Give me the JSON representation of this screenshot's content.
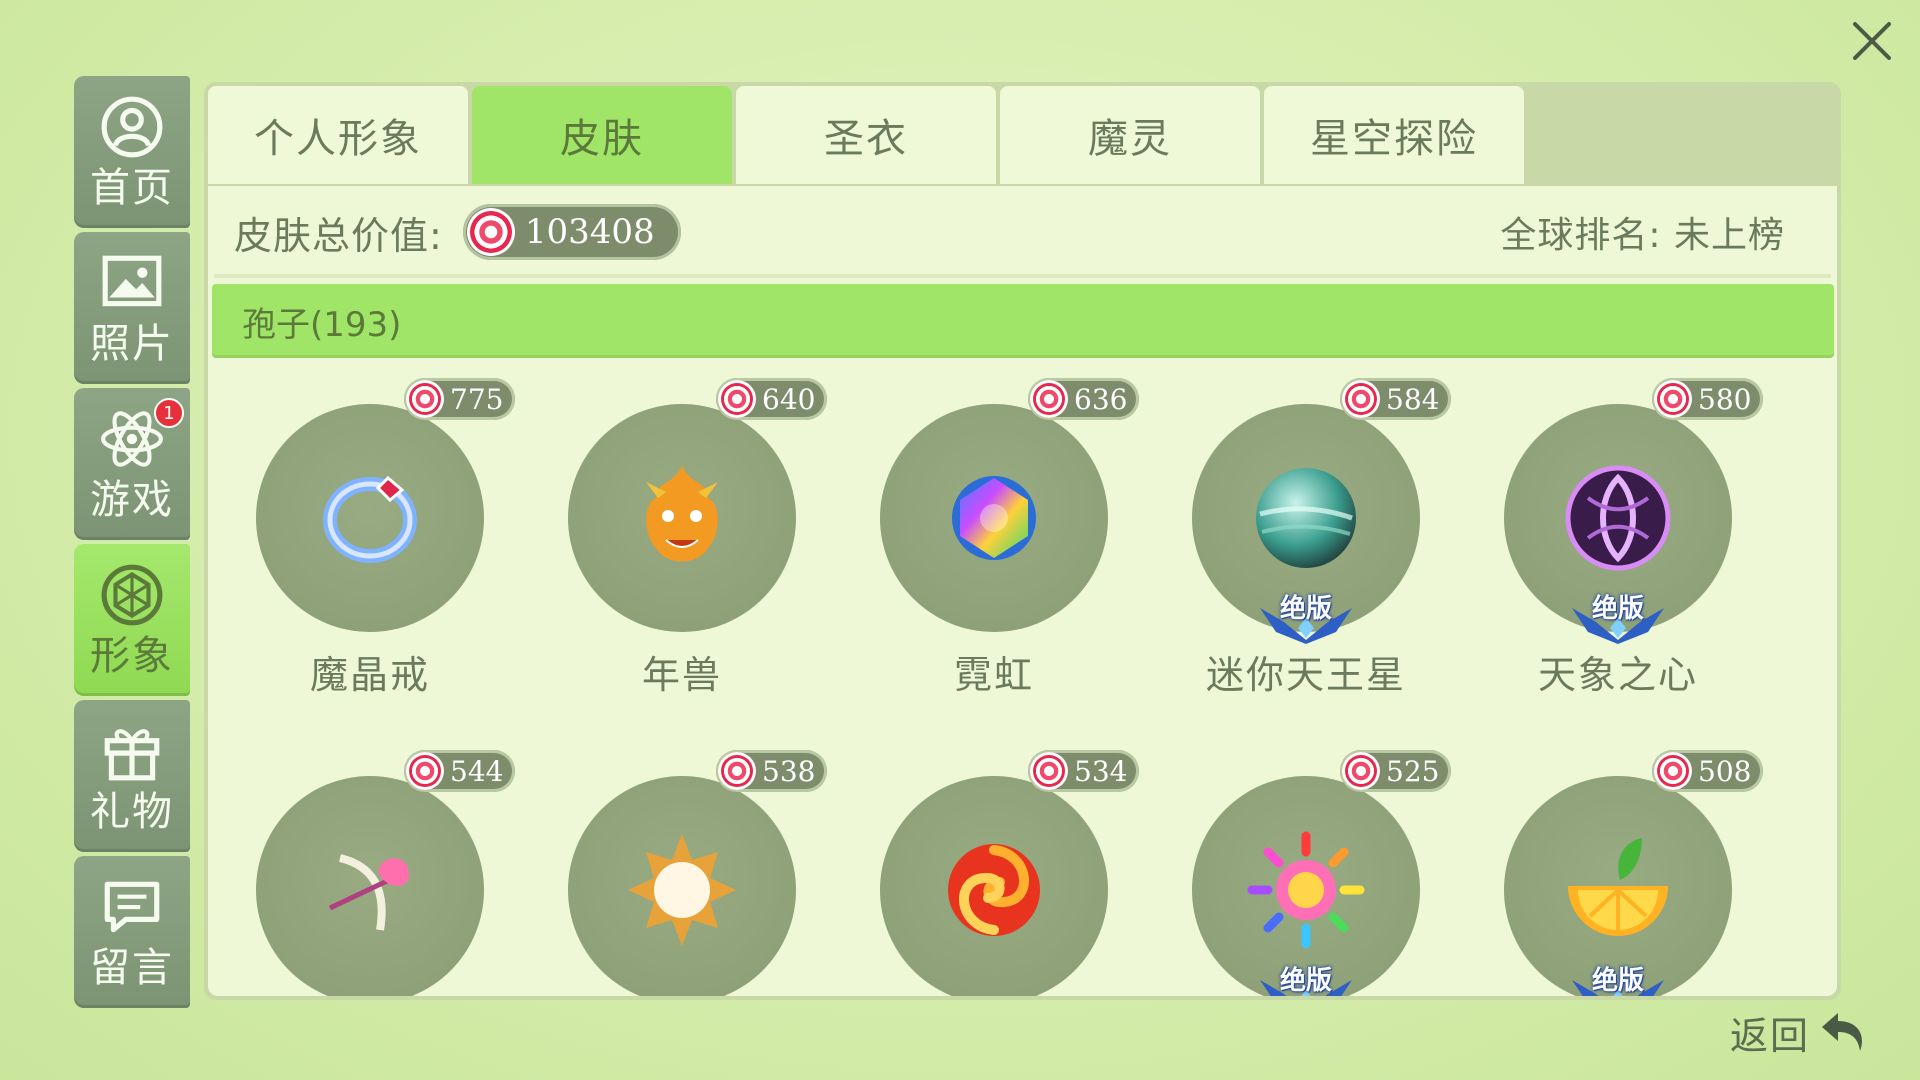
{
  "sidebar": {
    "items": [
      {
        "label": "首页",
        "icon": "user-icon"
      },
      {
        "label": "照片",
        "icon": "photo-icon"
      },
      {
        "label": "游戏",
        "icon": "atom-icon",
        "badge": "1"
      },
      {
        "label": "形象",
        "icon": "gem-icon",
        "active": true
      },
      {
        "label": "礼物",
        "icon": "gift-icon"
      },
      {
        "label": "留言",
        "icon": "message-icon"
      }
    ]
  },
  "tabs": [
    {
      "label": "个人形象"
    },
    {
      "label": "皮肤",
      "active": true
    },
    {
      "label": "圣衣"
    },
    {
      "label": "魔灵"
    },
    {
      "label": "星空探险"
    }
  ],
  "summary": {
    "label": "皮肤总价值:",
    "value": "103408",
    "rank": "全球排名: 未上榜"
  },
  "category": {
    "label": "孢子(193)"
  },
  "items": [
    {
      "name": "魔晶戒",
      "price": "775",
      "limited": ""
    },
    {
      "name": "年兽",
      "price": "640",
      "limited": ""
    },
    {
      "name": "霓虹",
      "price": "636",
      "limited": ""
    },
    {
      "name": "迷你天王星",
      "price": "584",
      "limited": "绝版"
    },
    {
      "name": "天象之心",
      "price": "580",
      "limited": "绝版"
    },
    {
      "name": "",
      "price": "544",
      "limited": ""
    },
    {
      "name": "",
      "price": "538",
      "limited": ""
    },
    {
      "name": "",
      "price": "534",
      "limited": ""
    },
    {
      "name": "",
      "price": "525",
      "limited": "绝版"
    },
    {
      "name": "",
      "price": "508",
      "limited": "绝版"
    }
  ],
  "back": {
    "label": "返回"
  },
  "colors": {
    "accent": "#a0e567",
    "panel": "#eef7d6",
    "sidebar": "#8ea585",
    "coin": "#e8274d"
  }
}
